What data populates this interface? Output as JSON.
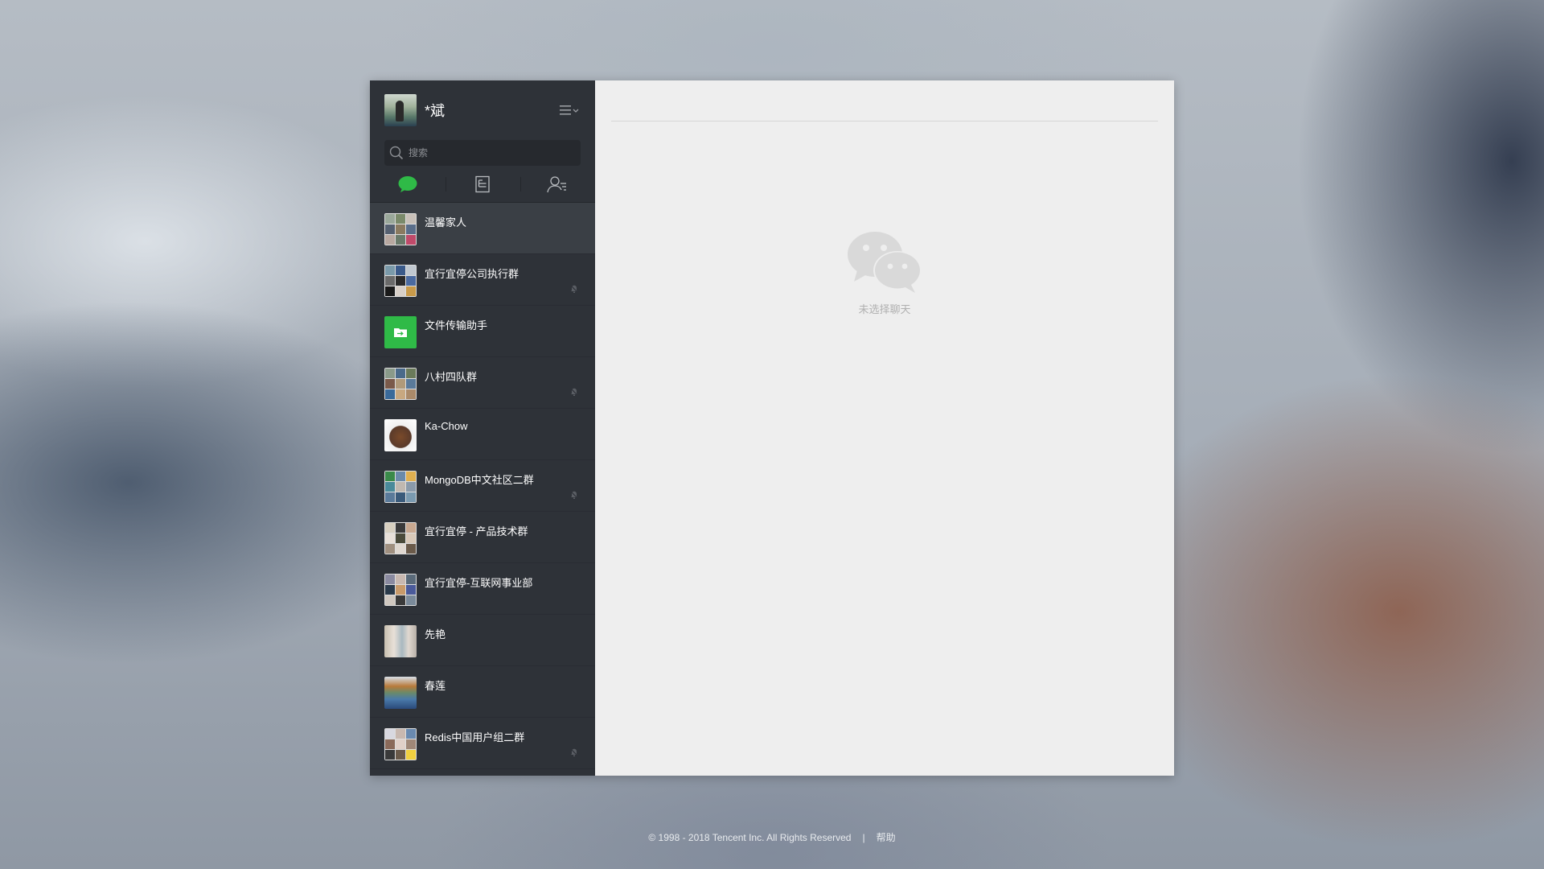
{
  "profile": {
    "name": "*斌"
  },
  "search": {
    "placeholder": "搜索"
  },
  "tabs": [
    {
      "id": "chats",
      "icon": "chat-bubble-icon",
      "active": true
    },
    {
      "id": "articles",
      "icon": "document-icon",
      "active": false
    },
    {
      "id": "contacts",
      "icon": "contacts-icon",
      "active": false
    }
  ],
  "chats": [
    {
      "name": "温馨家人",
      "muted": false,
      "avatar": "group-grid"
    },
    {
      "name": "宜行宜停公司执行群",
      "muted": true,
      "avatar": "group-grid"
    },
    {
      "name": "文件传输助手",
      "muted": false,
      "avatar": "file-transfer"
    },
    {
      "name": "八村四队群",
      "muted": true,
      "avatar": "group-grid"
    },
    {
      "name": "Ka-Chow",
      "muted": false,
      "avatar": "photo"
    },
    {
      "name": "MongoDB中文社区二群",
      "muted": true,
      "avatar": "group-grid"
    },
    {
      "name": "宜行宜停 - 产品技术群",
      "muted": false,
      "avatar": "group-grid"
    },
    {
      "name": "宜行宜停-互联网事业部",
      "muted": false,
      "avatar": "group-grid"
    },
    {
      "name": "先艳",
      "muted": false,
      "avatar": "photo"
    },
    {
      "name": "春莲",
      "muted": false,
      "avatar": "photo"
    },
    {
      "name": "Redis中国用户组二群",
      "muted": true,
      "avatar": "group-grid"
    }
  ],
  "main": {
    "empty_text": "未选择聊天"
  },
  "footer": {
    "copyright": "© 1998 - 2018 Tencent Inc. All Rights Reserved",
    "separator": "|",
    "help": "帮助"
  },
  "colors": {
    "sidebar": "#2e3238",
    "active_item": "#3a3f45",
    "accent_green": "#2fba47",
    "main_bg": "#eeeeee"
  }
}
